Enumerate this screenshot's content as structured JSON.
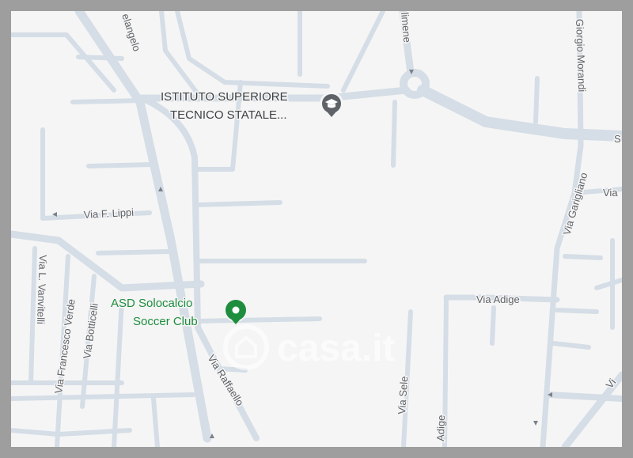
{
  "colors": {
    "frame": "#9e9e9e",
    "land": "#f5f5f5",
    "road": "#d5dde6",
    "street_text": "#5f6368",
    "school_text": "#3c4043",
    "school_pin": "#5f6368",
    "sport_text": "#1e8e3e",
    "sport_pin": "#1e8e3e"
  },
  "pois": {
    "school": {
      "line1": "ISTITUTO SUPERIORE",
      "line2": "TECNICO STATALE...",
      "icon": "graduation-cap-icon"
    },
    "soccer": {
      "line1": "ASD Solocalcio",
      "line2": "Soccer Club",
      "icon": "sports-pin-icon"
    }
  },
  "streets": {
    "michelangelo": "elangelo",
    "clemente": "limene",
    "giorgio_morandi": "Giorgio Morandi",
    "s_label": "S",
    "via_garigliano": "Via Garigliano",
    "via_right": "Via",
    "via_f_lippi": "Via F. Lippi",
    "via_l_vanvitelli": "Via L. Vanvitelli",
    "via_francesco_verde": "Via Francesco Verde",
    "via_botticelli": "Via Botticelli",
    "via_raffaello": "Via Raffaello",
    "via_adige": "Via Adige",
    "adige_lower": "Adige",
    "via_sele": "Via Sele",
    "via_lower_right": "Vi"
  },
  "watermark": {
    "text": "casa.it",
    "icon": "house-icon"
  }
}
